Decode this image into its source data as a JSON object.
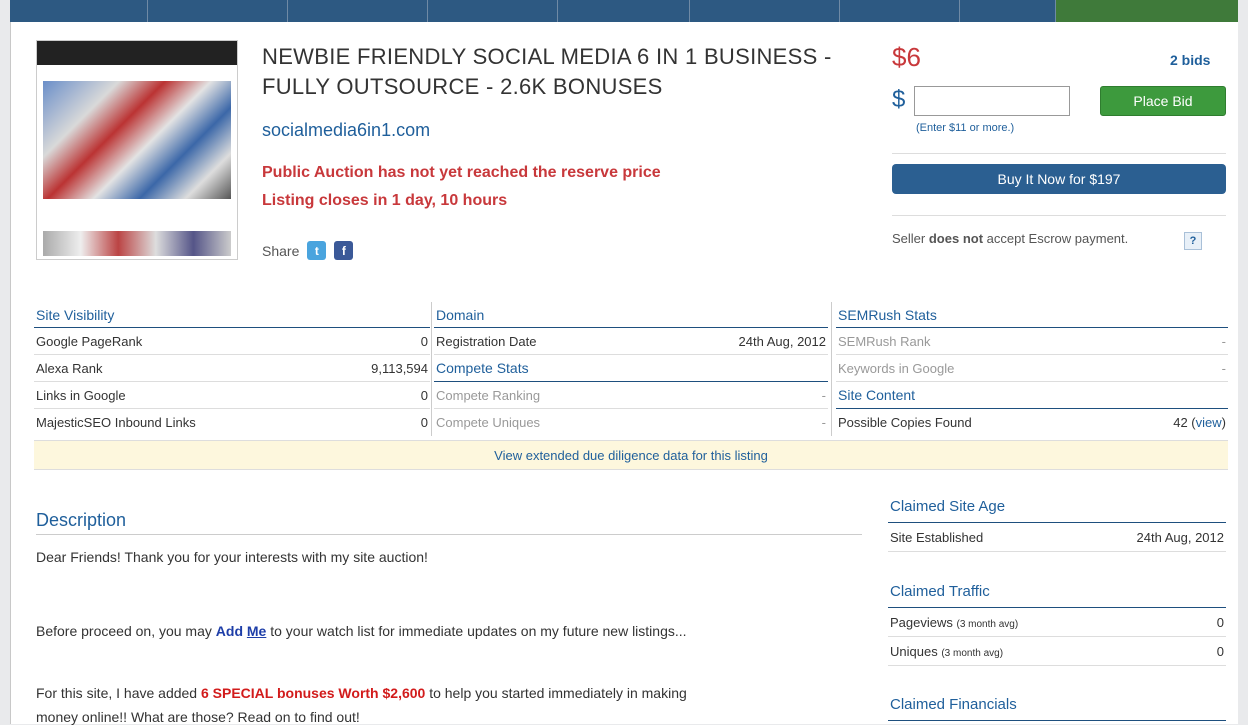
{
  "listing": {
    "title": "NEWBIE FRIENDLY SOCIAL MEDIA 6 IN 1 BUSINESS - FULLY OUTSOURCE - 2.6K BONUSES",
    "domain": "socialmedia6in1.com",
    "alert_reserve": "Public Auction has not yet reached the reserve price",
    "alert_closes": "Listing closes in 1 day, 10 hours",
    "share_label": "Share"
  },
  "bidding": {
    "current_price": "$6",
    "bids": "2 bids",
    "currency": "$",
    "bid_input_value": "",
    "place_bid_label": "Place Bid",
    "hint": "(Enter $11 or more.)",
    "buy_now_label": "Buy It Now for $197",
    "escrow_prefix": "Seller ",
    "escrow_bold": "does not",
    "escrow_suffix": " accept Escrow payment.",
    "help": "?"
  },
  "stats": {
    "site_visibility": {
      "heading": "Site Visibility",
      "rows": [
        {
          "label": "Google PageRank",
          "value": "0"
        },
        {
          "label": "Alexa Rank",
          "value": "9,113,594"
        },
        {
          "label": "Links in Google",
          "value": "0"
        },
        {
          "label": "MajesticSEO Inbound Links",
          "value": "0"
        }
      ]
    },
    "domain": {
      "heading": "Domain",
      "registration_label": "Registration Date",
      "registration_value": "24th Aug, 2012",
      "compete_heading": "Compete Stats",
      "compete_rows": [
        {
          "label": "Compete Ranking",
          "value": "-"
        },
        {
          "label": "Compete Uniques",
          "value": "-"
        }
      ]
    },
    "semrush": {
      "heading": "SEMRush Stats",
      "rows": [
        {
          "label": "SEMRush Rank",
          "value": "-"
        },
        {
          "label": "Keywords in Google",
          "value": "-"
        }
      ],
      "content_heading": "Site Content",
      "copies_label": "Possible Copies Found",
      "copies_value": "42",
      "copies_link": "view"
    },
    "extended_link": "View extended due diligence data for this listing"
  },
  "description": {
    "heading": "Description",
    "p1": "Dear Friends! Thank you for your interests with my site auction!",
    "p2_before": "Before proceed on, you may ",
    "p2_link_a": "Add ",
    "p2_link_b": "Me",
    "p2_after": " to your watch list for immediate updates on my future new listings...",
    "p3_before": "For this site, I have added ",
    "p3_bold": "6 SPECIAL bonuses Worth $2,600",
    "p3_after": " to help you started immediately in making",
    "p4": "money online!! What are those? Read on to find out!"
  },
  "sidebar": {
    "site_age": {
      "heading": "Claimed Site Age",
      "label": "Site Established",
      "value": "24th Aug, 2012"
    },
    "traffic": {
      "heading": "Claimed Traffic",
      "pageviews_label": "Pageviews",
      "uniques_label": "Uniques",
      "avg_note": "(3 month avg)",
      "pageviews_value": "0",
      "uniques_value": "0"
    },
    "financials": {
      "heading": "Claimed Financials"
    }
  },
  "colors": {
    "accent": "#1f5f9b",
    "alert": "#c8383b",
    "bid_green": "#3d9a3d",
    "nav_blue": "#2d5982"
  }
}
